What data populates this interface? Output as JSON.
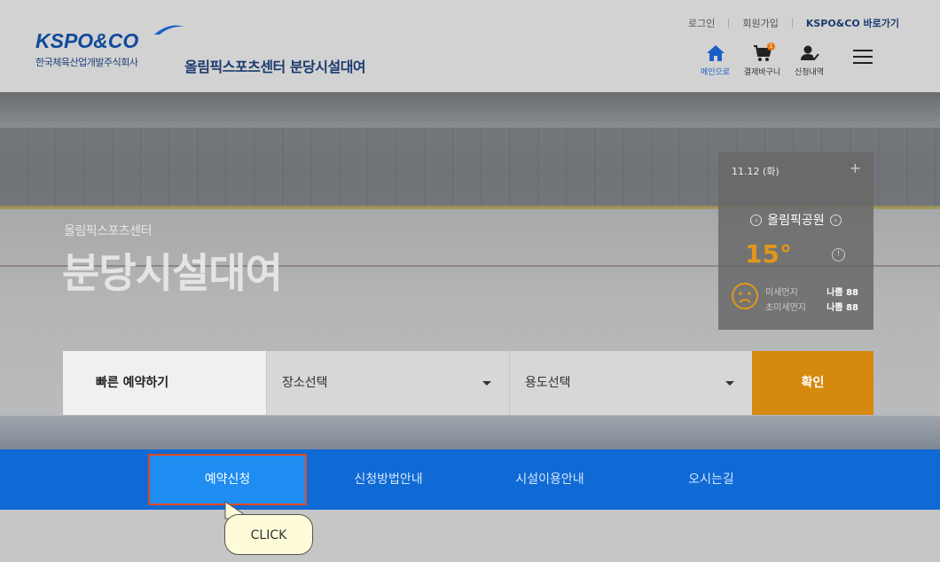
{
  "header": {
    "logo_text": "KSPO&CO",
    "logo_sub": "한국체육산업개발주식회사",
    "site_title": "올림픽스포츠센터 분당시설대여",
    "top_links": [
      "로그인",
      "회원가입",
      "KSPO&CO 바로가기"
    ],
    "quick_icons": [
      {
        "label": "메인으로",
        "icon": "home-icon",
        "active": true
      },
      {
        "label": "결제바구니",
        "icon": "cart-icon",
        "badge": "1"
      },
      {
        "label": "신청내역",
        "icon": "user-check-icon"
      }
    ],
    "menu_icon": "hamburger-icon"
  },
  "hero": {
    "subtitle": "올림픽스포츠센터",
    "title": "분당시설대여"
  },
  "weather": {
    "date": "11.12 (화)",
    "plus": "+",
    "location": "올림픽공원",
    "temperature": "15°",
    "info": "!",
    "rows": [
      {
        "label": "미세먼지",
        "value": "나쁨 88"
      },
      {
        "label": "초미세먼지",
        "value": "나쁨 88"
      }
    ]
  },
  "quick_reserve": {
    "label": "빠른 예약하기",
    "place_select": "장소선택",
    "purpose_select": "용도선택",
    "confirm": "확인"
  },
  "nav": {
    "items": [
      "예약신청",
      "신청방법안내",
      "시설이용안내",
      "오시는길"
    ]
  },
  "tooltip": {
    "text": "CLICK"
  },
  "colors": {
    "nav_bg": "#0f6ad6",
    "active_tab": "#1e8cf0",
    "highlight_border": "#e04a1e",
    "confirm_button": "#d6890f",
    "temperature": "#e2971b"
  }
}
